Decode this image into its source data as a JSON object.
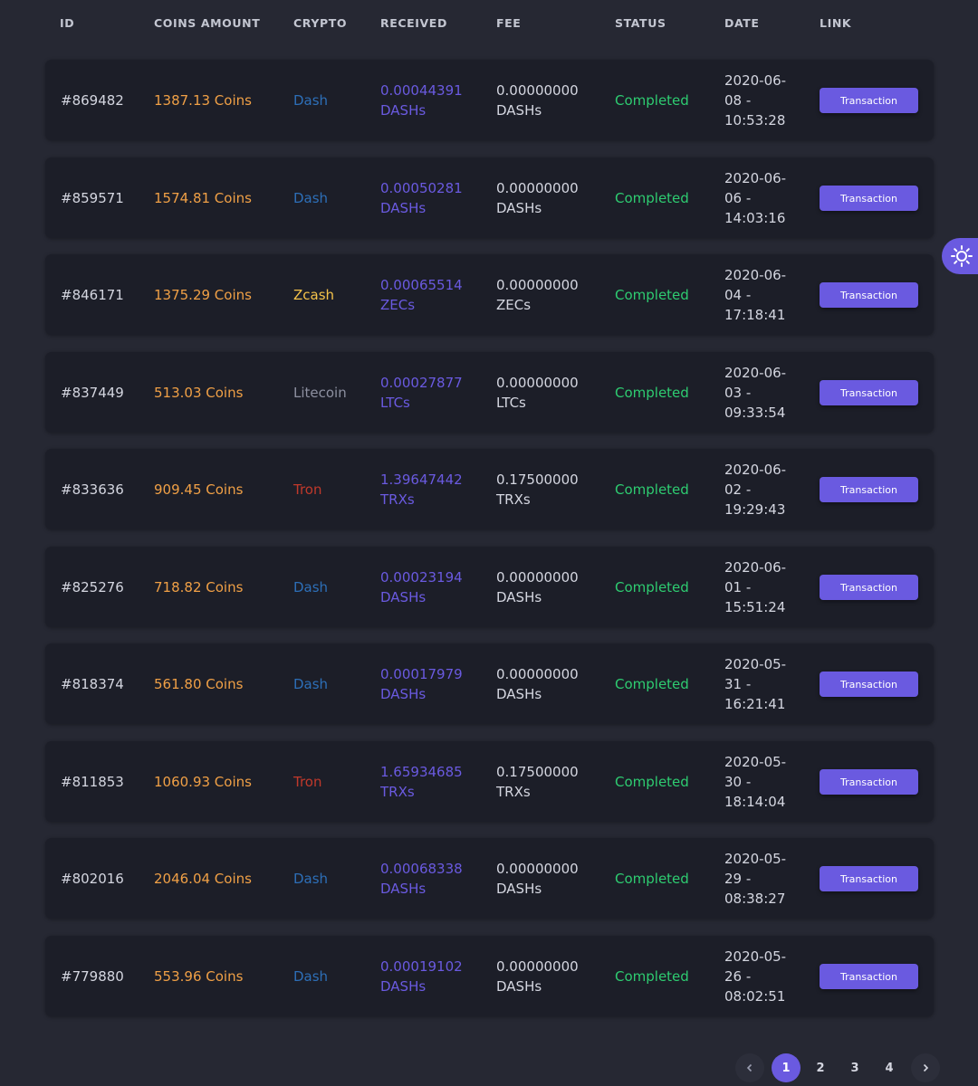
{
  "columns": {
    "id": "ID",
    "coins": "COINS AMOUNT",
    "crypto": "CRYPTO",
    "received": "RECEIVED",
    "fee": "FEE",
    "status": "STATUS",
    "date": "DATE",
    "link": "LINK"
  },
  "colors": {
    "accent": "#6a5ae0",
    "coins": "#f0a046",
    "completed": "#2ecc71",
    "dash": "#2d6fb8",
    "zcash": "#f5c34a",
    "litecoin": "#8d90a0",
    "tron": "#c0392b"
  },
  "rows": [
    {
      "id": "#869482",
      "coins": "1387.13 Coins",
      "crypto": "Dash",
      "crypto_key": "dash",
      "received_amount": "0.00044391",
      "received_unit": "DASHs",
      "fee_amount": "0.00000000",
      "fee_unit": "DASHs",
      "status": "Completed",
      "date_day": "2020-06-",
      "date_mid": "08 -",
      "date_time": "10:53:28",
      "link": "Transaction"
    },
    {
      "id": "#859571",
      "coins": "1574.81 Coins",
      "crypto": "Dash",
      "crypto_key": "dash",
      "received_amount": "0.00050281",
      "received_unit": "DASHs",
      "fee_amount": "0.00000000",
      "fee_unit": "DASHs",
      "status": "Completed",
      "date_day": "2020-06-",
      "date_mid": "06 -",
      "date_time": "14:03:16",
      "link": "Transaction"
    },
    {
      "id": "#846171",
      "coins": "1375.29 Coins",
      "crypto": "Zcash",
      "crypto_key": "zcash",
      "received_amount": "0.00065514",
      "received_unit": "ZECs",
      "fee_amount": "0.00000000",
      "fee_unit": "ZECs",
      "status": "Completed",
      "date_day": "2020-06-",
      "date_mid": "04 -",
      "date_time": "17:18:41",
      "link": "Transaction"
    },
    {
      "id": "#837449",
      "coins": "513.03 Coins",
      "crypto": "Litecoin",
      "crypto_key": "litecoin",
      "received_amount": "0.00027877",
      "received_unit": "LTCs",
      "fee_amount": "0.00000000",
      "fee_unit": "LTCs",
      "status": "Completed",
      "date_day": "2020-06-",
      "date_mid": "03 -",
      "date_time": "09:33:54",
      "link": "Transaction"
    },
    {
      "id": "#833636",
      "coins": "909.45 Coins",
      "crypto": "Tron",
      "crypto_key": "tron",
      "received_amount": "1.39647442",
      "received_unit": "TRXs",
      "fee_amount": "0.17500000",
      "fee_unit": "TRXs",
      "status": "Completed",
      "date_day": "2020-06-",
      "date_mid": "02 -",
      "date_time": "19:29:43",
      "link": "Transaction"
    },
    {
      "id": "#825276",
      "coins": "718.82 Coins",
      "crypto": "Dash",
      "crypto_key": "dash",
      "received_amount": "0.00023194",
      "received_unit": "DASHs",
      "fee_amount": "0.00000000",
      "fee_unit": "DASHs",
      "status": "Completed",
      "date_day": "2020-06-",
      "date_mid": "01 -",
      "date_time": "15:51:24",
      "link": "Transaction"
    },
    {
      "id": "#818374",
      "coins": "561.80 Coins",
      "crypto": "Dash",
      "crypto_key": "dash",
      "received_amount": "0.00017979",
      "received_unit": "DASHs",
      "fee_amount": "0.00000000",
      "fee_unit": "DASHs",
      "status": "Completed",
      "date_day": "2020-05-",
      "date_mid": "31 -",
      "date_time": "16:21:41",
      "link": "Transaction"
    },
    {
      "id": "#811853",
      "coins": "1060.93 Coins",
      "crypto": "Tron",
      "crypto_key": "tron",
      "received_amount": "1.65934685",
      "received_unit": "TRXs",
      "fee_amount": "0.17500000",
      "fee_unit": "TRXs",
      "status": "Completed",
      "date_day": "2020-05-",
      "date_mid": "30 -",
      "date_time": "18:14:04",
      "link": "Transaction"
    },
    {
      "id": "#802016",
      "coins": "2046.04 Coins",
      "crypto": "Dash",
      "crypto_key": "dash",
      "received_amount": "0.00068338",
      "received_unit": "DASHs",
      "fee_amount": "0.00000000",
      "fee_unit": "DASHs",
      "status": "Completed",
      "date_day": "2020-05-",
      "date_mid": "29 -",
      "date_time": "08:38:27",
      "link": "Transaction"
    },
    {
      "id": "#779880",
      "coins": "553.96 Coins",
      "crypto": "Dash",
      "crypto_key": "dash",
      "received_amount": "0.00019102",
      "received_unit": "DASHs",
      "fee_amount": "0.00000000",
      "fee_unit": "DASHs",
      "status": "Completed",
      "date_day": "2020-05-",
      "date_mid": "26 -",
      "date_time": "08:02:51",
      "link": "Transaction"
    }
  ],
  "pagination": {
    "prev_icon": "chevron-left-icon",
    "next_icon": "chevron-right-icon",
    "pages": [
      "1",
      "2",
      "3",
      "4"
    ],
    "current": "1"
  },
  "theme_toggle": {
    "icon": "sun-icon"
  }
}
